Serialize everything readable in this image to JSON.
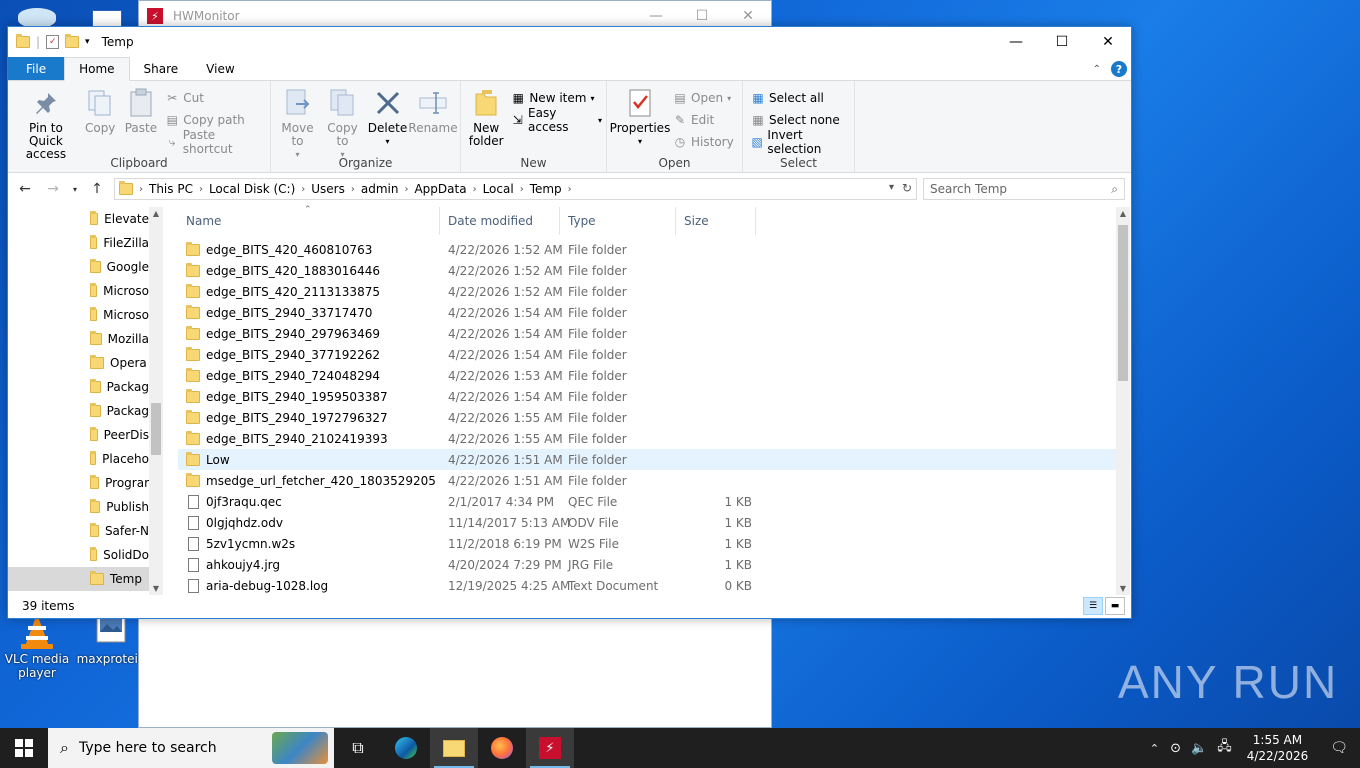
{
  "desktop": {
    "icons": [
      {
        "label": "VLC media player"
      },
      {
        "label": "maxprotein"
      }
    ],
    "watermark": "ANY RUN"
  },
  "hwmonitor": {
    "title": "HWMonitor"
  },
  "explorer": {
    "title": "Temp",
    "tabs": [
      "File",
      "Home",
      "Share",
      "View"
    ],
    "ribbon": {
      "clipboard": {
        "name": "Clipboard",
        "pin": "Pin to Quick access",
        "copy": "Copy",
        "paste": "Paste",
        "cut": "Cut",
        "copy_path": "Copy path",
        "paste_shortcut": "Paste shortcut"
      },
      "organize": {
        "name": "Organize",
        "move_to": "Move to",
        "copy_to": "Copy to",
        "delete": "Delete",
        "rename": "Rename"
      },
      "new": {
        "name": "New",
        "new_folder": "New folder",
        "new_item": "New item",
        "easy_access": "Easy access"
      },
      "open": {
        "name": "Open",
        "properties": "Properties",
        "open": "Open",
        "edit": "Edit",
        "history": "History"
      },
      "select": {
        "name": "Select",
        "select_all": "Select all",
        "select_none": "Select none",
        "invert": "Invert selection"
      }
    },
    "breadcrumb": [
      "This PC",
      "Local Disk (C:)",
      "Users",
      "admin",
      "AppData",
      "Local",
      "Temp"
    ],
    "search_placeholder": "Search Temp",
    "nav_items": [
      "Elevate",
      "FileZilla",
      "Google",
      "Microso",
      "Microso",
      "Mozilla",
      "Opera",
      "Packag",
      "Packag",
      "PeerDis",
      "Placeho",
      "Prograr",
      "Publish",
      "Safer-N",
      "SolidDo",
      "Temp"
    ],
    "columns": [
      "Name",
      "Date modified",
      "Type",
      "Size"
    ],
    "files": [
      {
        "name": "edge_BITS_420_460810763",
        "date": "4/22/2026 1:52 AM",
        "type": "File folder",
        "size": "",
        "kind": "folder"
      },
      {
        "name": "edge_BITS_420_1883016446",
        "date": "4/22/2026 1:52 AM",
        "type": "File folder",
        "size": "",
        "kind": "folder"
      },
      {
        "name": "edge_BITS_420_2113133875",
        "date": "4/22/2026 1:52 AM",
        "type": "File folder",
        "size": "",
        "kind": "folder"
      },
      {
        "name": "edge_BITS_2940_33717470",
        "date": "4/22/2026 1:54 AM",
        "type": "File folder",
        "size": "",
        "kind": "folder"
      },
      {
        "name": "edge_BITS_2940_297963469",
        "date": "4/22/2026 1:54 AM",
        "type": "File folder",
        "size": "",
        "kind": "folder"
      },
      {
        "name": "edge_BITS_2940_377192262",
        "date": "4/22/2026 1:54 AM",
        "type": "File folder",
        "size": "",
        "kind": "folder"
      },
      {
        "name": "edge_BITS_2940_724048294",
        "date": "4/22/2026 1:53 AM",
        "type": "File folder",
        "size": "",
        "kind": "folder"
      },
      {
        "name": "edge_BITS_2940_1959503387",
        "date": "4/22/2026 1:54 AM",
        "type": "File folder",
        "size": "",
        "kind": "folder"
      },
      {
        "name": "edge_BITS_2940_1972796327",
        "date": "4/22/2026 1:55 AM",
        "type": "File folder",
        "size": "",
        "kind": "folder"
      },
      {
        "name": "edge_BITS_2940_2102419393",
        "date": "4/22/2026 1:55 AM",
        "type": "File folder",
        "size": "",
        "kind": "folder"
      },
      {
        "name": "Low",
        "date": "4/22/2026 1:51 AM",
        "type": "File folder",
        "size": "",
        "kind": "folder",
        "highlight": true
      },
      {
        "name": "msedge_url_fetcher_420_1803529205",
        "date": "4/22/2026 1:51 AM",
        "type": "File folder",
        "size": "",
        "kind": "folder"
      },
      {
        "name": "0jf3raqu.qec",
        "date": "2/1/2017 4:34 PM",
        "type": "QEC File",
        "size": "1 KB",
        "kind": "file"
      },
      {
        "name": "0lgjqhdz.odv",
        "date": "11/14/2017 5:13 AM",
        "type": "ODV File",
        "size": "1 KB",
        "kind": "file"
      },
      {
        "name": "5zv1ycmn.w2s",
        "date": "11/2/2018 6:19 PM",
        "type": "W2S File",
        "size": "1 KB",
        "kind": "file"
      },
      {
        "name": "ahkoujy4.jrg",
        "date": "4/20/2024 7:29 PM",
        "type": "JRG File",
        "size": "1 KB",
        "kind": "file"
      },
      {
        "name": "aria-debug-1028.log",
        "date": "12/19/2025 4:25 AM",
        "type": "Text Document",
        "size": "0 KB",
        "kind": "file"
      }
    ],
    "status": "39 items"
  },
  "taskbar": {
    "search_placeholder": "Type here to search",
    "time": "1:55 AM",
    "date": "4/22/2026"
  }
}
